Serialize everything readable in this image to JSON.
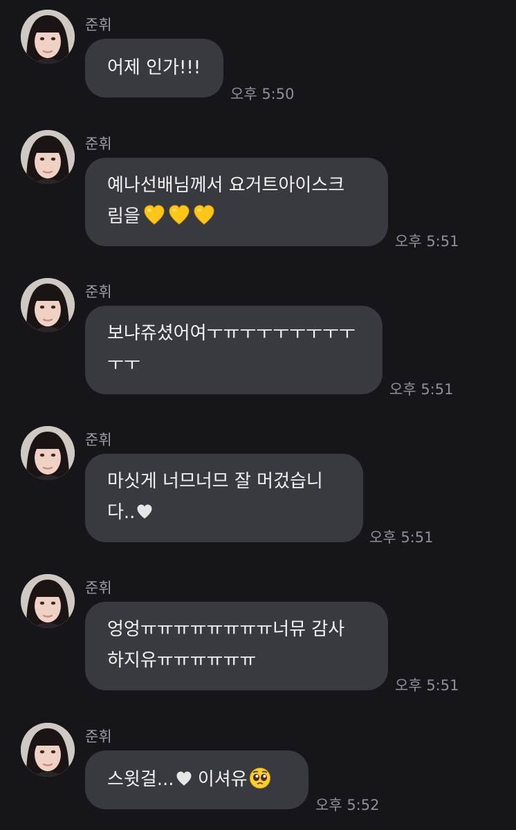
{
  "messages": [
    {
      "sender": "준휘",
      "lines": [
        "어제 인가!!!"
      ],
      "time": "오후 5:50"
    },
    {
      "sender": "준휘",
      "lines": [
        "예나선배님께서 요거트아이스크",
        "림을"
      ],
      "emoji": [
        "yellow-heart",
        "yellow-heart",
        "yellow-heart"
      ],
      "time": "오후 5:51"
    },
    {
      "sender": "준휘",
      "lines": [
        "보냐쥬셨어여ㅜㅠㅜㅜㅜㅜㅜㅜㅜ",
        "ㅜㅜ"
      ],
      "time": "오후 5:51"
    },
    {
      "sender": "준휘",
      "lines": [
        "마싯게 너므너므 잘 머겄습니",
        "다.."
      ],
      "emoji": [
        "white-heart"
      ],
      "time": "오후 5:51"
    },
    {
      "sender": "준휘",
      "lines": [
        "엉엉ㅠㅠㅠㅠㅠㅠㅠㅠ너뮤 감사",
        "하지유ㅠㅠㅠㅠㅠㅠ"
      ],
      "time": "오후 5:51"
    },
    {
      "sender": "준휘",
      "lines": [
        "스윗걸...",
        " 이셔유"
      ],
      "emoji": [
        "white-heart",
        "pleading-face"
      ],
      "time": "오후 5:52"
    }
  ],
  "colors": {
    "background": "#16161a",
    "bubble": "#393a40",
    "text": "#f2f2f2",
    "meta": "#8f8f95"
  }
}
